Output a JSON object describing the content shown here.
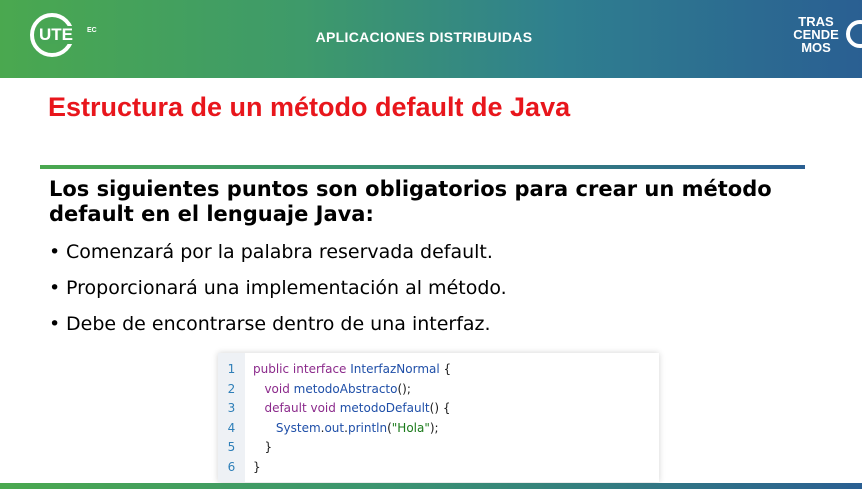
{
  "header": {
    "logo_left": "UTE",
    "logo_left_suffix": "EC",
    "title": "APLICACIONES DISTRIBUIDAS",
    "logo_right_lines": [
      "TRAS",
      "CEN",
      "DE",
      "MOS"
    ]
  },
  "slide": {
    "title": "Estructura de un método default de Java",
    "intro": "Los siguientes puntos son obligatorios para crear un método default en el lenguaje Java:",
    "bullet_symbol": "•",
    "bullets": [
      "Comenzará por la palabra reservada default.",
      "Proporcionará una implementación al método.",
      "Debe de encontrarse dentro de una interfaz."
    ]
  },
  "code": {
    "line_numbers": [
      "1",
      "2",
      "3",
      "4",
      "5",
      "6"
    ],
    "lines": [
      [
        {
          "t": "public interface ",
          "c": "kw"
        },
        {
          "t": "InterfazNormal",
          "c": "ty"
        },
        {
          "t": " {",
          "c": "pl"
        }
      ],
      [
        {
          "t": "   ",
          "c": "pl"
        },
        {
          "t": "void ",
          "c": "kw"
        },
        {
          "t": "metodoAbstracto",
          "c": "fn"
        },
        {
          "t": "();",
          "c": "pl"
        }
      ],
      [
        {
          "t": "   ",
          "c": "pl"
        },
        {
          "t": "default void ",
          "c": "kw"
        },
        {
          "t": "metodoDefault",
          "c": "fn"
        },
        {
          "t": "() {",
          "c": "pl"
        }
      ],
      [
        {
          "t": "      ",
          "c": "pl"
        },
        {
          "t": "System",
          "c": "ty"
        },
        {
          "t": ".",
          "c": "pl"
        },
        {
          "t": "out",
          "c": "ty"
        },
        {
          "t": ".",
          "c": "pl"
        },
        {
          "t": "println",
          "c": "fn"
        },
        {
          "t": "(",
          "c": "pl"
        },
        {
          "t": "\"Hola\"",
          "c": "str"
        },
        {
          "t": ");",
          "c": "pl"
        }
      ],
      [
        {
          "t": "   }",
          "c": "pl"
        }
      ],
      [
        {
          "t": "}",
          "c": "pl"
        }
      ]
    ]
  },
  "colors": {
    "title_red": "#e8161c",
    "brand_green": "#4aa84f",
    "brand_blue": "#2a5f92"
  }
}
